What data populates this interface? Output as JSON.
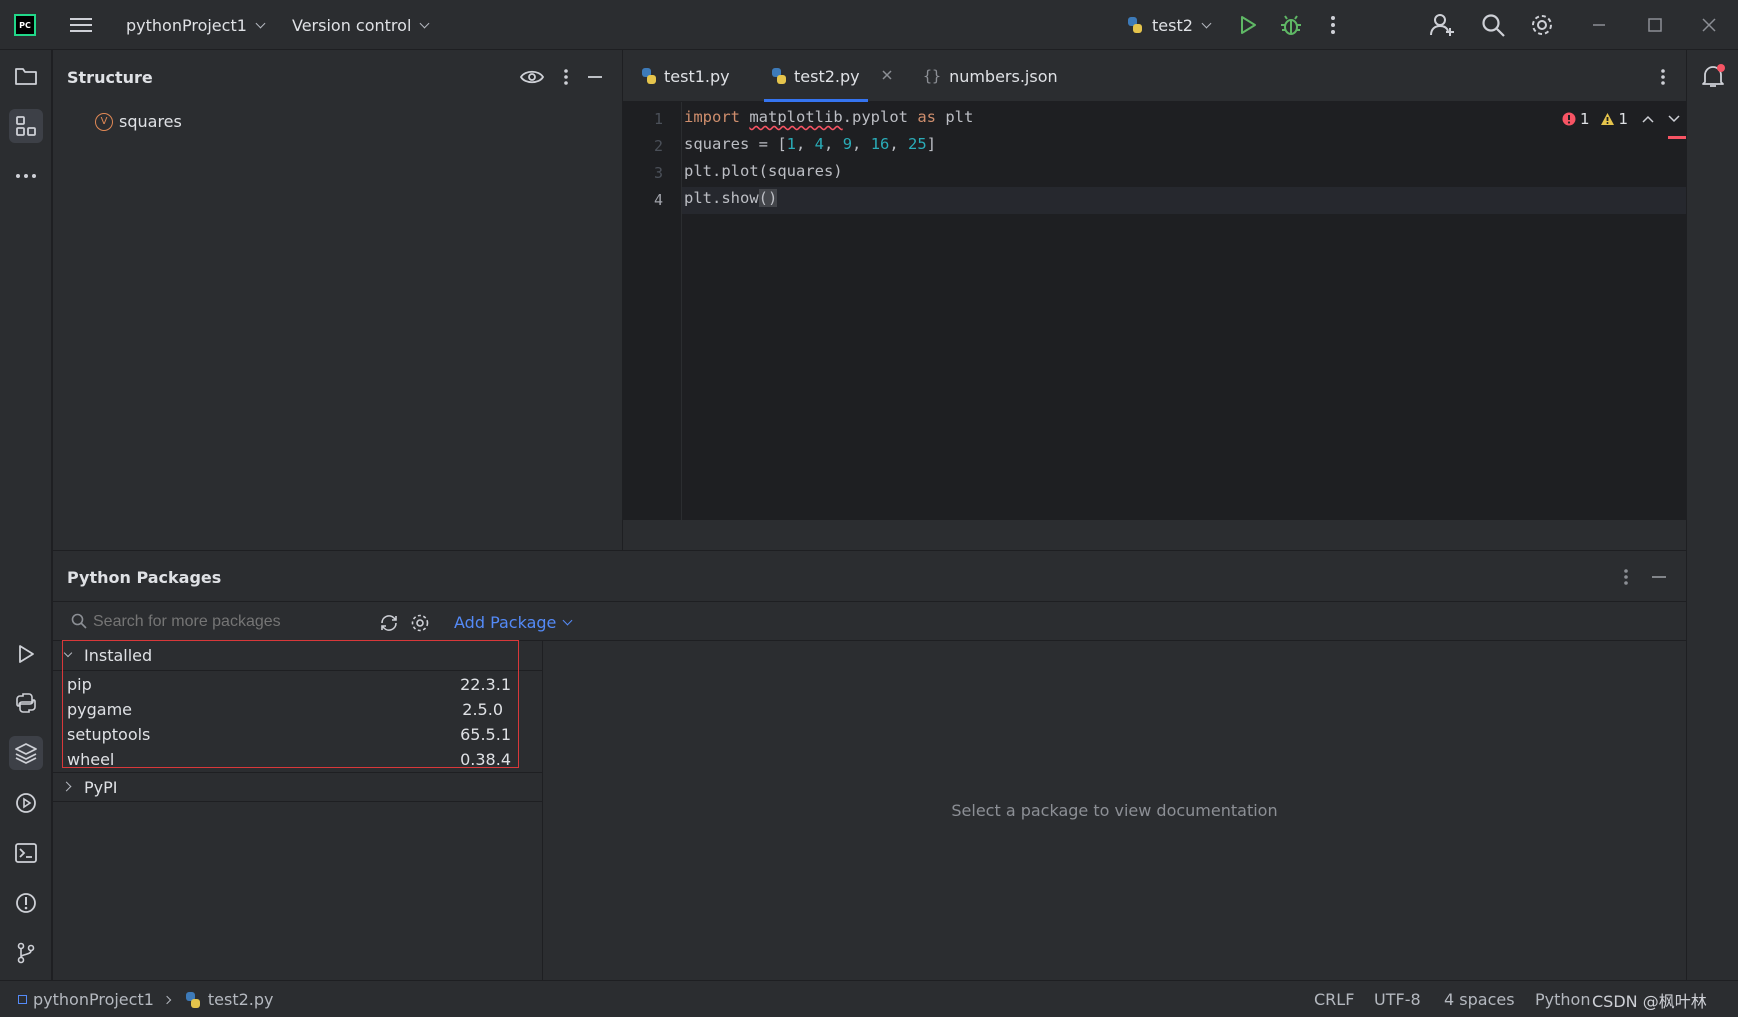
{
  "titlebar": {
    "app_logo": "PC",
    "project": "pythonProject1",
    "vcs": "Version control",
    "run_config": "test2"
  },
  "structure": {
    "title": "Structure",
    "items": [
      {
        "badge": "V",
        "label": "squares"
      }
    ]
  },
  "editor": {
    "tabs": [
      {
        "label": "test1.py",
        "icon": "python-file-icon"
      },
      {
        "label": "test2.py",
        "icon": "python-file-icon",
        "active": true
      },
      {
        "label": "numbers.json",
        "icon": "json-file-icon"
      }
    ],
    "line_numbers": [
      "1",
      "2",
      "3",
      "4"
    ],
    "inspections": {
      "errors": "1",
      "warnings": "1"
    }
  },
  "packages": {
    "title": "Python Packages",
    "search_placeholder": "Search for more packages",
    "add_package": "Add Package",
    "installed_label": "Installed",
    "installed": [
      {
        "name": "pip",
        "version": "22.3.1"
      },
      {
        "name": "pygame",
        "version": "2.5.0"
      },
      {
        "name": "setuptools",
        "version": "65.5.1"
      },
      {
        "name": "wheel",
        "version": "0.38.4"
      }
    ],
    "pypi_label": "PyPI",
    "doc_placeholder": "Select a package to view documentation"
  },
  "statusbar": {
    "breadcrumb_project": "pythonProject1",
    "breadcrumb_file": "test2.py",
    "line_sep": "CRLF",
    "encoding": "UTF-8",
    "indent": "4 spaces",
    "interpreter": "Python",
    "watermark": "CSDN @枫叶林"
  },
  "colors": {
    "accent": "#3574f0",
    "error": "#f75464",
    "highlight_box": "#d9383a",
    "run_green": "#5fb865"
  }
}
